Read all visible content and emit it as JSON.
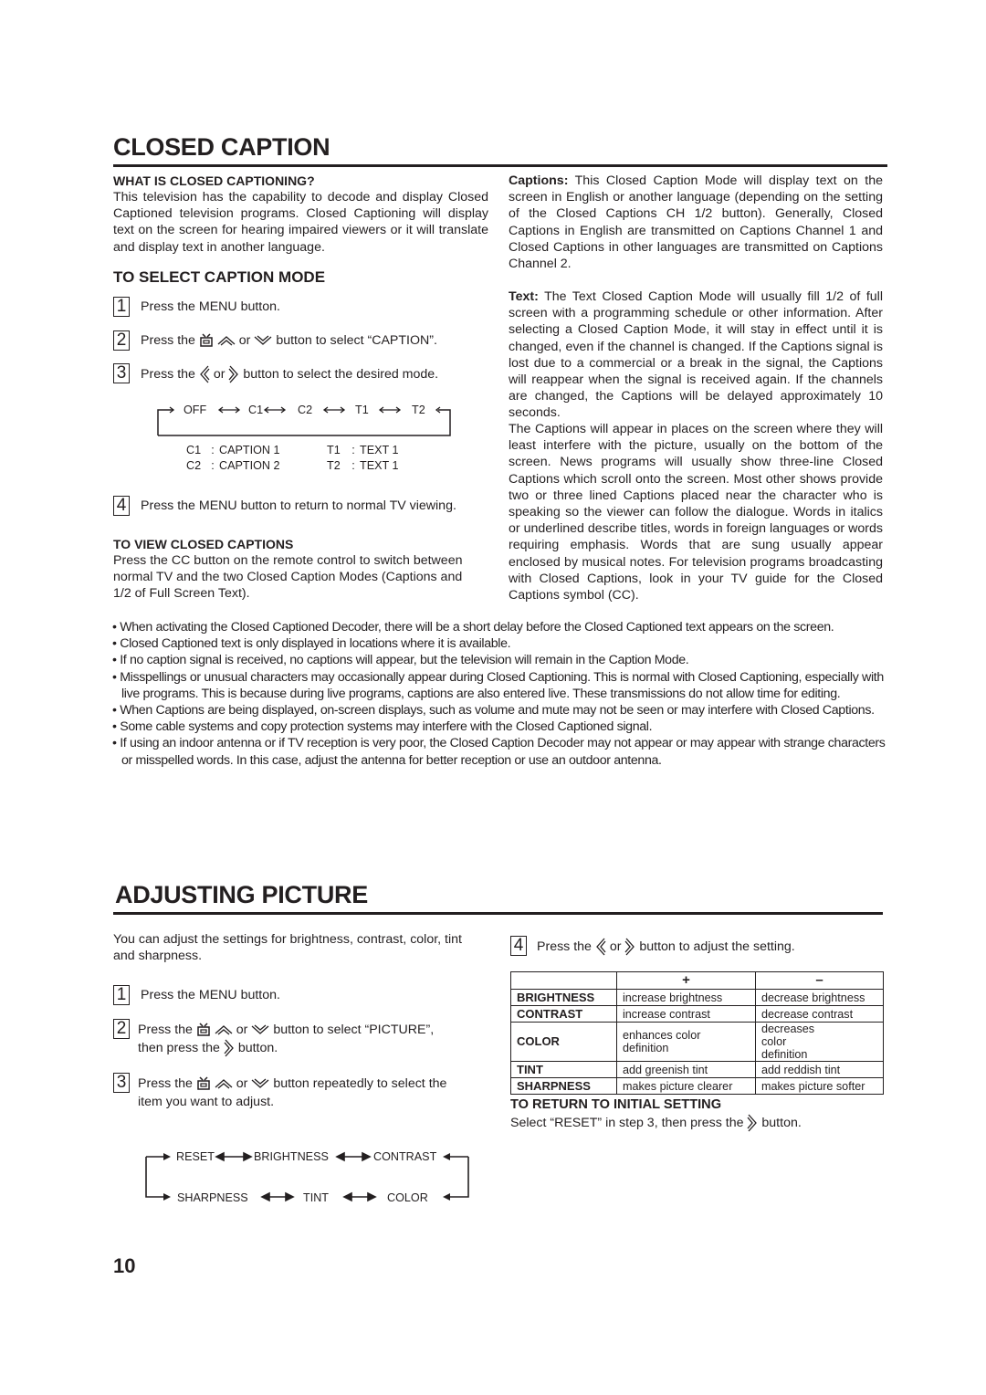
{
  "closed_caption": {
    "title": "CLOSED CAPTION",
    "what_is": {
      "heading": "WHAT IS CLOSED CAPTIONING?",
      "body": "This television has the capability to decode and display Closed Captioned television programs. Closed Captioning will display text on the screen for hearing impaired viewers or it will translate and display text in another language."
    },
    "select_mode": {
      "heading": "TO SELECT CAPTION MODE",
      "steps": [
        {
          "num": "1",
          "text": "Press the MENU button."
        },
        {
          "num": "2",
          "pre": "Press the",
          "or": "or",
          "post": "button to select “CAPTION”."
        },
        {
          "num": "3",
          "pre": "Press the",
          "or": "or",
          "post": "button to select the desired mode."
        },
        {
          "num": "4",
          "text": "Press the MENU button to return to normal TV viewing."
        }
      ],
      "cycle": [
        "OFF",
        "C1",
        "C2",
        "T1",
        "T2"
      ],
      "legend": [
        {
          "code": "C1",
          "sep": ":",
          "label": "CAPTION 1"
        },
        {
          "code": "C2",
          "sep": ":",
          "label": "CAPTION 2"
        },
        {
          "code": "T1",
          "sep": ":",
          "label": "TEXT 1"
        },
        {
          "code": "T2",
          "sep": ":",
          "label": "TEXT 1"
        }
      ]
    },
    "view": {
      "heading": "TO VIEW CLOSED CAPTIONS",
      "body": "Press the CC button on the remote control to switch between normal TV and the two Closed Caption Modes (Captions and 1/2 of Full Screen Text)."
    },
    "captions_para": {
      "label": "Captions:",
      "body": " This Closed Caption Mode will display text on the screen in English or another language (depending on the setting of the Closed Captions CH 1/2 button). Generally, Closed Captions in English are transmitted on Captions Channel 1 and Closed Captions in other languages are transmitted on Captions Channel 2."
    },
    "text_para": {
      "label": "Text:",
      "body": " The Text Closed Caption Mode will usually fill 1/2 of full screen with a programming schedule or other information. After selecting a Closed Caption Mode, it will stay in effect until it is changed, even if the channel is changed. If the Captions signal is lost due to a commercial or a break in the signal, the Captions will reappear when the signal is received again. If the channels are changed, the Captions will be delayed approximately 10 seconds."
    },
    "placement_para": "The Captions will appear in places on the screen where they will least interfere with the picture, usually on the bottom of the screen. News programs will usually show three-line Closed Captions which scroll onto the screen. Most other shows provide two or three lined Captions placed near the character who is speaking so the viewer can follow the dialogue. Words in italics or underlined describe titles, words in foreign languages or words requiring emphasis. Words that are sung usually appear enclosed by musical notes. For television programs broadcasting with Closed Captions, look in your TV guide for the Closed Captions symbol (CC).",
    "bullet_glyph": "•",
    "notes": [
      "When activating the Closed Captioned Decoder, there will be a short delay before the Closed Captioned text appears on the screen.",
      "Closed Captioned text is only displayed in locations where it is available.",
      "If no caption signal is received, no captions will appear, but the television will remain in the Caption Mode.",
      "Misspellings or unusual characters may occasionally appear during Closed Captioning. This is normal with Closed Captioning, especially with live programs. This is because during live programs, captions are also entered live. These transmissions do not allow time for editing.",
      "When Captions are being displayed, on-screen displays, such as volume and mute may not be seen or may interfere with Closed Captions.",
      "Some cable systems and copy protection systems may interfere with the Closed Captioned signal.",
      "If using an indoor antenna or if TV reception is very poor, the Closed Caption Decoder may not appear or may appear with strange characters or misspelled words. In this case, adjust the antenna for better reception or use an outdoor antenna."
    ]
  },
  "adjusting_picture": {
    "title": "ADJUSTING PICTURE",
    "intro": "You can adjust the settings for brightness, contrast, color, tint and sharpness.",
    "steps": [
      {
        "num": "1",
        "text": "Press the MENU button."
      },
      {
        "num": "2",
        "pre": "Press the",
        "or": "or",
        "post": "button to select “PICTURE”,",
        "line2_pre": "then press the",
        "line2_post": "button."
      },
      {
        "num": "3",
        "pre": "Press the",
        "or": "or",
        "post": "button repeatedly to select the",
        "line2": "item you want to adjust."
      },
      {
        "num": "4",
        "pre": "Press the",
        "or": "or",
        "post": "button to adjust the setting."
      }
    ],
    "cycle_top": [
      "RESET",
      "BRIGHTNESS",
      "CONTRAST"
    ],
    "cycle_bottom": [
      "SHARPNESS",
      "TINT",
      "COLOR"
    ],
    "table": {
      "headers": [
        "",
        "+",
        "–"
      ],
      "rows": [
        [
          "BRIGHTNESS",
          "increase brightness",
          "decrease brightness"
        ],
        [
          "CONTRAST",
          "increase contrast",
          "decrease contrast"
        ],
        [
          "COLOR",
          "enhances color definition",
          "decreases color definition"
        ],
        [
          "TINT",
          "add greenish tint",
          "add reddish tint"
        ],
        [
          "SHARPNESS",
          "makes picture clearer",
          "makes picture softer"
        ]
      ]
    },
    "reset": {
      "heading": "TO RETURN TO INITIAL SETTING",
      "pre": "Select “RESET” in step 3, then press the",
      "post": "button."
    }
  },
  "page_number": "10"
}
